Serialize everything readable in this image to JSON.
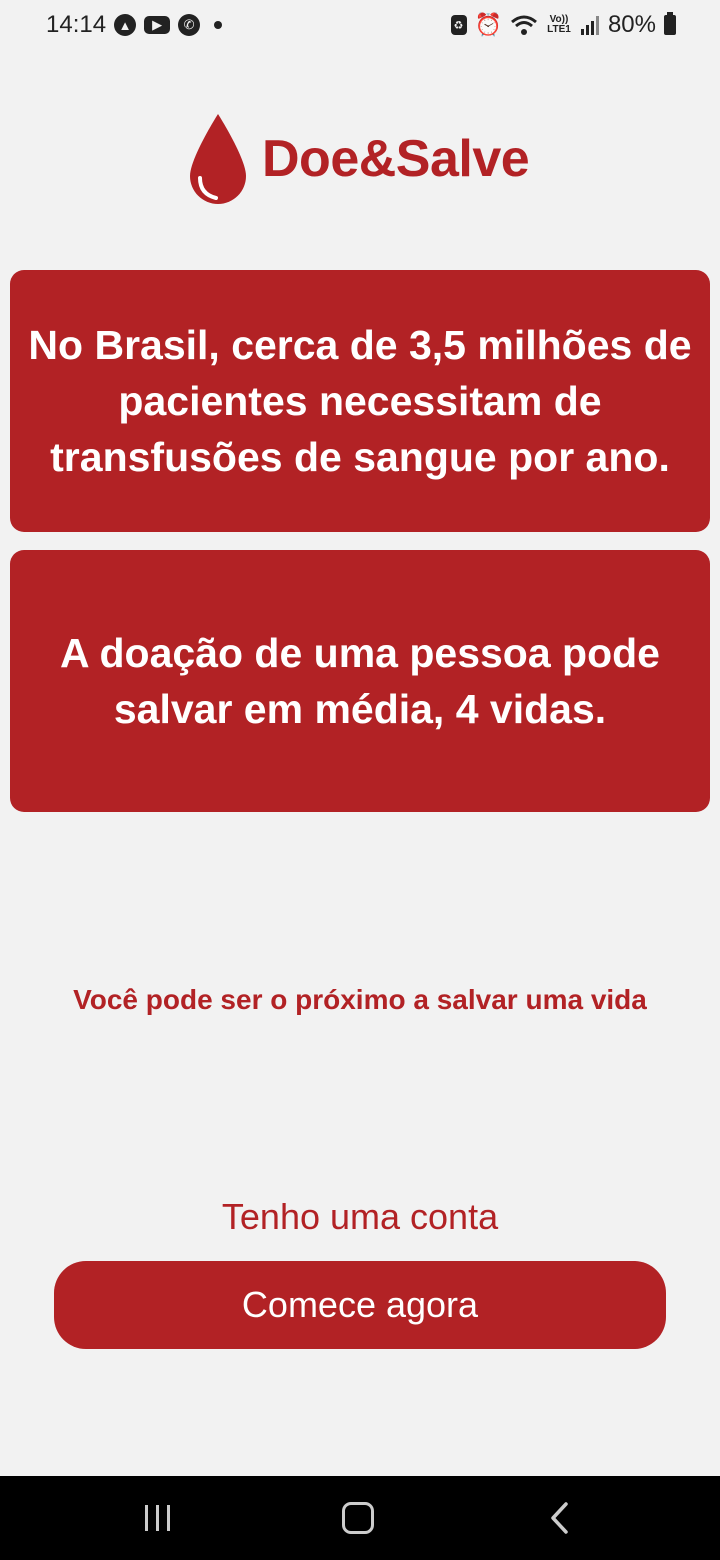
{
  "status_bar": {
    "time": "14:14",
    "battery": "80%",
    "left_icons": [
      "navigation-icon",
      "youtube-icon",
      "whatsapp-icon",
      "dot-icon"
    ],
    "right_icons": [
      "lock-icon",
      "alarm-icon",
      "wifi-icon",
      "volte-icon",
      "signal-icon",
      "battery-icon"
    ],
    "volte_label": "Vo)) LTE1"
  },
  "brand": {
    "name": "Doe&Salve",
    "color": "#b22225"
  },
  "facts": [
    {
      "text": "No Brasil, cerca de 3,5 milhões de pacientes necessitam de transfusões de sangue por ano."
    },
    {
      "text": "A doação de uma pessoa pode salvar em média, 4 vidas."
    }
  ],
  "tagline": "Você pode ser o próximo a salvar uma vida",
  "actions": {
    "login_link": "Tenho uma conta",
    "start_button": "Comece agora"
  },
  "nav_bar": {
    "buttons": [
      "recent-apps",
      "home",
      "back"
    ]
  }
}
